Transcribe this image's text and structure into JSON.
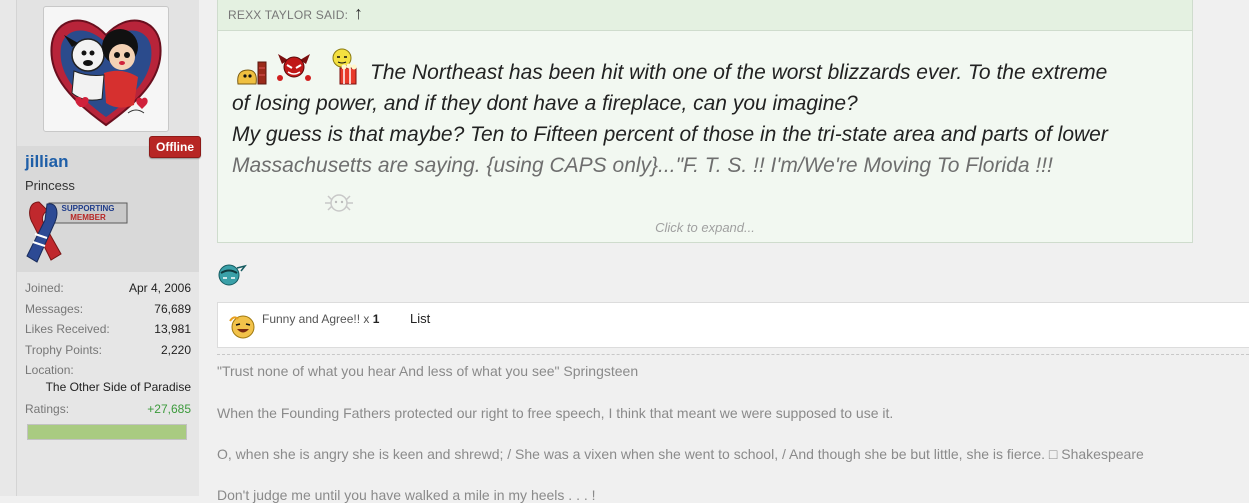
{
  "user": {
    "username": "jillian",
    "title": "Princess",
    "status_badge": "Offline",
    "supporting_badge": [
      "SUPPORTING",
      "MEMBER"
    ],
    "stats": [
      {
        "label": "Joined:",
        "value": "Apr 4, 2006"
      },
      {
        "label": "Messages:",
        "value": "76,689"
      },
      {
        "label": "Likes Received:",
        "value": "13,981"
      },
      {
        "label": "Trophy Points:",
        "value": "2,220"
      },
      {
        "label": "Location:",
        "value": ""
      },
      {
        "label": "",
        "value": "The Other Side of Paradise"
      },
      {
        "label": "Ratings:",
        "value": "+27,685"
      }
    ],
    "rating_fill_percent": 100,
    "colors": {
      "username": "#1f5fa8",
      "ratings": "#3b9a3b",
      "rating_bar": "#a9cb81",
      "badge": "#b72624"
    }
  },
  "quote": {
    "author": "REXX TAYLOR SAID:",
    "arrow": "↑",
    "lines": [
      "The Northeast has been hit with one of the worst blizzards ever. To the extreme",
      "of losing power, and if they dont have a fireplace, can you imagine?",
      "My guess is that maybe? Ten to Fifteen percent of those in the tri-state area and parts of lower",
      "Massachusetts are saying. {using CAPS only}...\"F. T. S. !! I'm/We're Moving To Florida !!!"
    ],
    "expand_label": "Click to expand...",
    "icons": [
      "fireplace-smiley-icon",
      "devil-smiley-icon",
      "popcorn-smiley-icon",
      "snowflake-smiley-icon"
    ]
  },
  "reply_icon": "sleepy-face-icon",
  "reactions": {
    "text": "Funny and Agree!!",
    "multiplier": "x",
    "count": "1",
    "list_label": "List",
    "icon": "laughing-face-icon"
  },
  "signature": [
    "\"Trust none of what you hear And less of what you see\" Springsteen",
    "When the Founding Fathers protected our right to free speech, I think that meant we were supposed to use it.",
    "O, when she is angry she is keen and shrewd; / She was a vixen when she went to school, / And though she be but little, she is fierce. □ Shakespeare",
    "Don't judge me until you have walked a mile in my heels . . . !"
  ]
}
